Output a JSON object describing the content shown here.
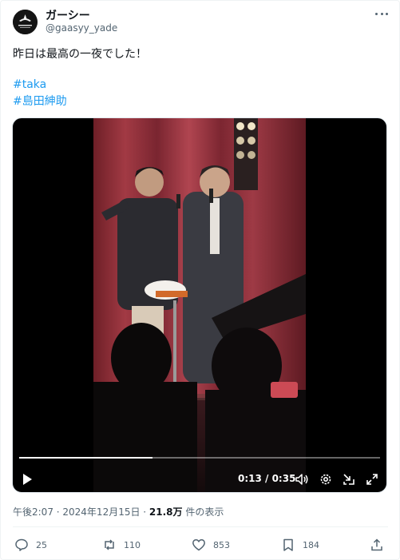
{
  "author": {
    "display_name": "ガーシー",
    "handle": "@gaasyy_yade",
    "avatar_icon": "logo-avatar-icon"
  },
  "post": {
    "text": "昨日は最高の一夜でした！",
    "hashtags": [
      "#taka",
      "#島田紳助"
    ]
  },
  "video": {
    "current_time": "0:13",
    "duration": "0:35",
    "time_display": "0:13 / 0:35",
    "progress": 0.37,
    "icons": [
      "play-icon",
      "volume-icon",
      "settings-gear-icon",
      "pop-out-icon",
      "fullscreen-icon"
    ]
  },
  "meta": {
    "timestamp": "午後2:07 · 2024年12月15日 · ",
    "views_count": "21.8万",
    "views_label": " 件の表示"
  },
  "actions": {
    "replies": "25",
    "reposts": "110",
    "likes": "853",
    "bookmarks": "184"
  },
  "colors": {
    "accent": "#1d9bf0",
    "text_primary": "#0f1419",
    "text_secondary": "#536471",
    "stage_curtain": "#8e2c36"
  }
}
